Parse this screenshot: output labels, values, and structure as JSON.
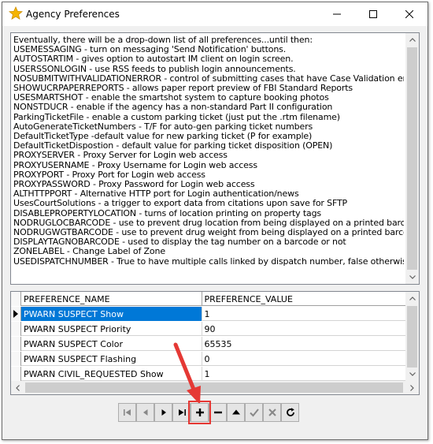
{
  "window": {
    "title": "Agency Preferences",
    "icon": "star-icon",
    "controls": [
      "minimize-icon",
      "maximize-icon",
      "close-icon"
    ]
  },
  "notes": {
    "lines": [
      "Eventually, there will be a drop-down list of all preferences...until then:",
      "USEMESSAGING - turn on messaging 'Send Notification' buttons.",
      "AUTOSTARTIM - gives option to autostart IM client on login screen.",
      "USERSSONLOGIN - use RSS feeds to publish login announcements.",
      "NOSUBMITWITHVALIDATIONERROR - control of submitting cases that have Case Validation errors",
      "SHOWUCRPAPERREPORTS - allows paper report preview of FBI Standard Reports",
      "USESMARTSHOT - enable the smartshot system to capture booking photos",
      "NONSTDUCR - enable if the agency has a non-standard Part II configuration",
      "ParkingTicketFile - enable a custom parking ticket (just put the .rtm filename)",
      "AutoGenerateTicketNumbers - T/F for auto-gen parking ticket numbers",
      "DefaultTicketType -default value for new parking ticket (P for example)",
      "DefaultTicketDispostion - default value for parking ticket disposition (OPEN)",
      "PROXYSERVER - Proxy Server for Login web access",
      "PROXYUSERNAME - Proxy Username for Login web access",
      "PROXYPORT - Proxy Port for Login web access",
      "PROXYPASSWORD - Proxy Password for Login web access",
      "ALTHTTPPORT - Alternative HTTP port for Login authentication/news",
      "UsesCourtSolutions - a trigger to export data from citations upon save for SFTP",
      "DISABLEPROPERTYLOCATION - turns of location printing on property tags",
      "NODRUGLOCBARCODE - use to prevent drug location from being displayed on a printed barcode.",
      "NODRUGWGTBARCODE - use to prevent drug weight from being displayed on a printed barcode.",
      "DISPLAYTAGNOBARCODE - used to display the tag number on a barcode or not",
      "ZONELABEL - Change Label of Zone",
      "USEDISPATCHNUMBER - True to have multiple calls linked by dispatch number, false otherwise"
    ]
  },
  "grid": {
    "columns": [
      "PREFERENCE_NAME",
      "PREFERENCE_VALUE"
    ],
    "rows": [
      {
        "name": "PWARN SUSPECT Show",
        "value": "1"
      },
      {
        "name": "PWARN SUSPECT Priority",
        "value": "90"
      },
      {
        "name": "PWARN SUSPECT Color",
        "value": "65535"
      },
      {
        "name": "PWARN SUSPECT Flashing",
        "value": "0"
      },
      {
        "name": "PWARN CIVIL_REQUESTED Show",
        "value": "1"
      }
    ],
    "selected_row": 0
  },
  "navigator": {
    "buttons": [
      {
        "name": "first-record-button",
        "icon": "first-icon",
        "enabled": false
      },
      {
        "name": "prior-record-button",
        "icon": "prior-icon",
        "enabled": false
      },
      {
        "name": "next-record-button",
        "icon": "next-icon",
        "enabled": true
      },
      {
        "name": "last-record-button",
        "icon": "last-icon",
        "enabled": true
      },
      {
        "name": "insert-record-button",
        "icon": "plus-icon",
        "enabled": true,
        "highlighted": true
      },
      {
        "name": "delete-record-button",
        "icon": "minus-icon",
        "enabled": true
      },
      {
        "name": "edit-record-button",
        "icon": "edit-icon",
        "enabled": true
      },
      {
        "name": "post-edit-button",
        "icon": "check-icon",
        "enabled": false
      },
      {
        "name": "cancel-edit-button",
        "icon": "cancel-icon",
        "enabled": false
      },
      {
        "name": "refresh-button",
        "icon": "refresh-icon",
        "enabled": true
      }
    ]
  },
  "colors": {
    "selection": "#0078d7",
    "annotation": "#e53935"
  }
}
